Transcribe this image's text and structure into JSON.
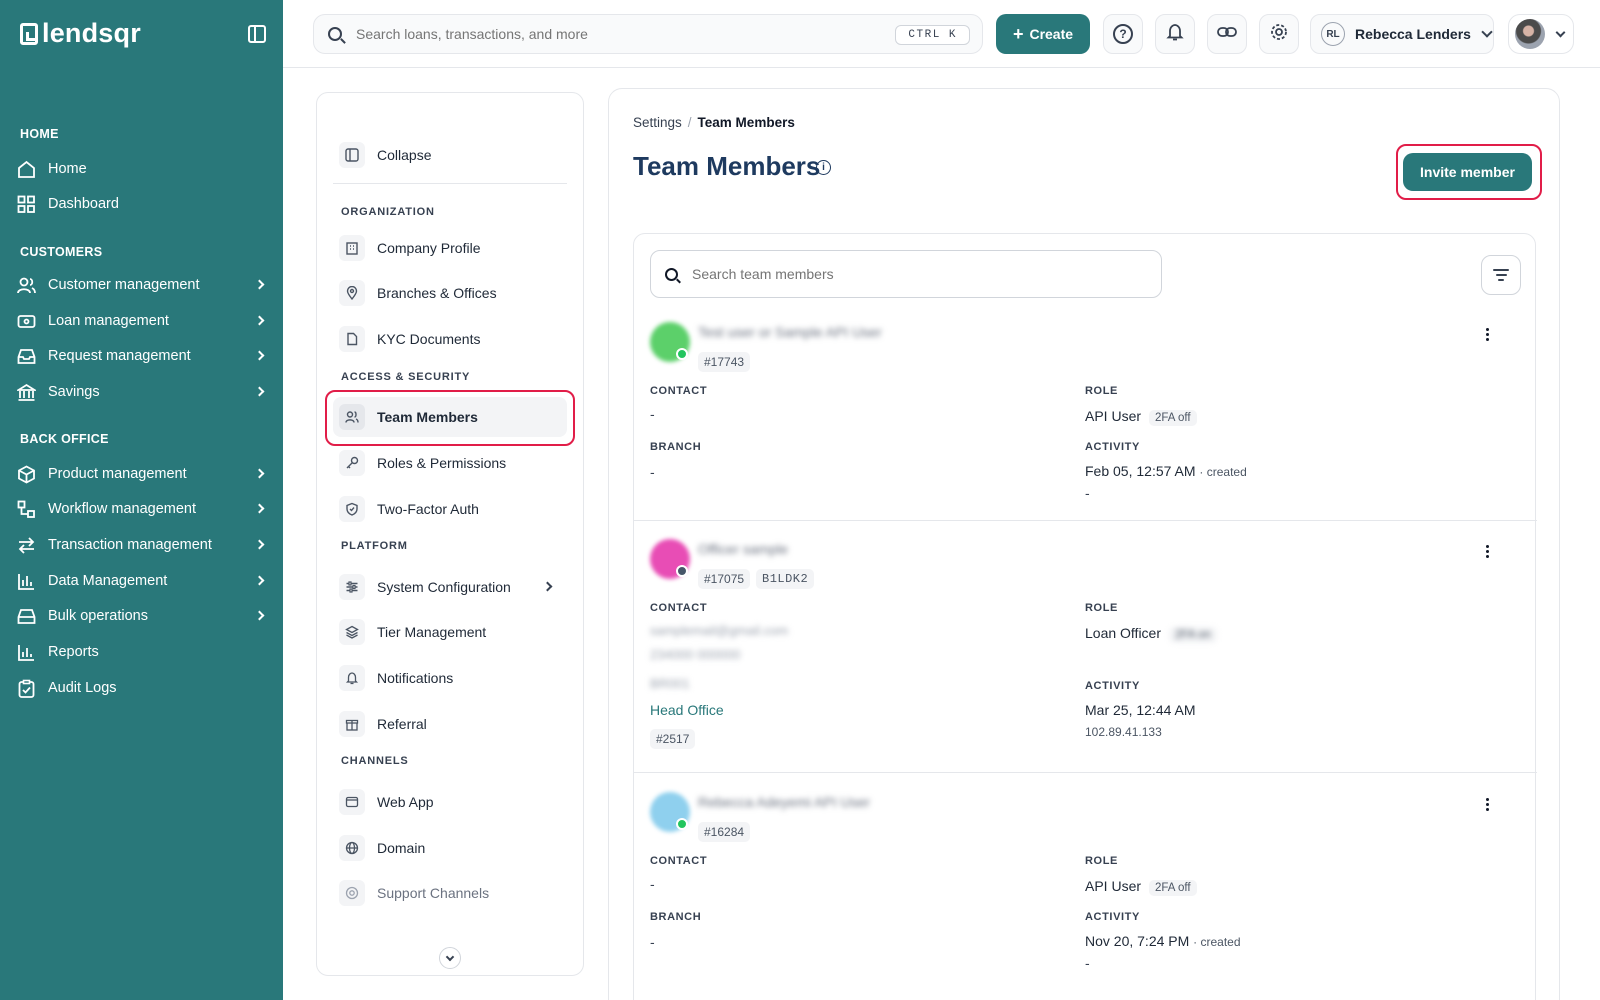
{
  "nav": {
    "brand": "lendsqr",
    "sections": [
      "HOME",
      "CUSTOMERS",
      "BACK OFFICE"
    ],
    "items": [
      {
        "label": "Home",
        "icon": "home-icon"
      },
      {
        "label": "Dashboard",
        "icon": "dashboard-icon"
      },
      {
        "label": "Customer management",
        "icon": "users-icon"
      },
      {
        "label": "Loan management",
        "icon": "loan-icon"
      },
      {
        "label": "Request management",
        "icon": "inbox-icon"
      },
      {
        "label": "Savings",
        "icon": "savings-icon"
      },
      {
        "label": "Product management",
        "icon": "box-icon"
      },
      {
        "label": "Workflow management",
        "icon": "workflow-icon"
      },
      {
        "label": "Transaction management",
        "icon": "transfer-icon"
      },
      {
        "label": "Data Management",
        "icon": "bar-chart-icon"
      },
      {
        "label": "Bulk operations",
        "icon": "tray-icon"
      },
      {
        "label": "Reports",
        "icon": "reports-icon"
      },
      {
        "label": "Audit Logs",
        "icon": "clipboard-icon"
      }
    ]
  },
  "topbar": {
    "search_placeholder": "Search loans, transactions, and more",
    "shortcut": "CTRL K",
    "create_label": "Create",
    "user_initials": "RL",
    "user_name": "Rebecca Lenders"
  },
  "settings_nav": {
    "collapse_label": "Collapse",
    "sections": [
      "ORGANIZATION",
      "ACCESS & SECURITY",
      "PLATFORM",
      "CHANNELS"
    ],
    "items": [
      {
        "label": "Company Profile",
        "icon": "building-icon"
      },
      {
        "label": "Branches & Offices",
        "icon": "map-pin-icon"
      },
      {
        "label": "KYC Documents",
        "icon": "document-icon"
      },
      {
        "label": "Team Members",
        "icon": "team-icon"
      },
      {
        "label": "Roles & Permissions",
        "icon": "key-icon"
      },
      {
        "label": "Two-Factor Auth",
        "icon": "shield-icon"
      },
      {
        "label": "System Configuration",
        "icon": "sliders-icon"
      },
      {
        "label": "Tier Management",
        "icon": "layers-icon"
      },
      {
        "label": "Notifications",
        "icon": "bell-icon"
      },
      {
        "label": "Referral",
        "icon": "gift-icon"
      },
      {
        "label": "Web App",
        "icon": "browser-icon"
      },
      {
        "label": "Domain",
        "icon": "globe-icon"
      },
      {
        "label": "Support Channels",
        "icon": "lifebuoy-icon"
      }
    ]
  },
  "main": {
    "breadcrumb": {
      "parent": "Settings",
      "current": "Team Members"
    },
    "title": "Team Members",
    "invite_label": "Invite member",
    "search_placeholder": "Search team members",
    "labels": {
      "contact": "CONTACT",
      "role": "ROLE",
      "branch": "BRANCH",
      "activity": "ACTIVITY"
    },
    "members": [
      {
        "name": "Test user or Sample API User",
        "id": "#17743",
        "avatar_color": "#5cd06a",
        "status_color": "#22c55e",
        "contact": "-",
        "branch": "-",
        "role": "API User",
        "role_badge": "2FA off",
        "activity_time": "Feb 05, 12:57 AM",
        "activity_note": "· created",
        "activity_sub": "-"
      },
      {
        "name": "Officer sample",
        "id": "#17075",
        "code": "B1LDK2",
        "avatar_color": "#e84db5",
        "status_color": "#475569",
        "contact_email": "samplemail@gmail.com",
        "contact_phone": "234000 000000",
        "branch_code": "BR001",
        "branch": "Head Office",
        "branch_id": "#2517",
        "role": "Loan Officer",
        "role_badge": "2FA on",
        "activity_time": "Mar 25, 12:44 AM",
        "activity_sub": "102.89.41.133"
      },
      {
        "name": "Rebecca Adeyemi API User",
        "id": "#16284",
        "avatar_color": "#8fd0ee",
        "status_color": "#22c55e",
        "contact": "-",
        "branch": "-",
        "role": "API User",
        "role_badge": "2FA off",
        "activity_time": "Nov 20, 7:24 PM",
        "activity_note": "· created",
        "activity_sub": "-"
      }
    ]
  }
}
